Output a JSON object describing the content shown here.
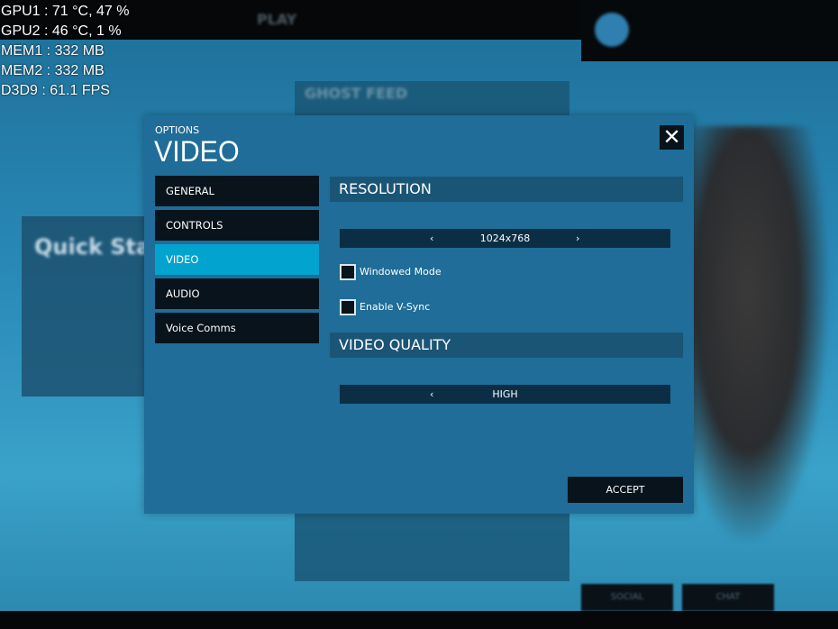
{
  "background": {
    "play_label": "PLAY",
    "feed_title": "GHOST FEED",
    "quick_start": "Quick Start",
    "social_tab": "SOCIAL",
    "chat_tab": "CHAT"
  },
  "hud": {
    "lines": [
      "GPU1  : 71 °C, 47 %",
      "GPU2  : 46 °C, 1 %",
      "MEM1 : 332 MB",
      "MEM2 : 332 MB",
      "D3D9  : 61.1 FPS"
    ]
  },
  "modal": {
    "subtitle": "OPTIONS",
    "title": "VIDEO",
    "close_icon": "close-x",
    "nav": [
      {
        "label": "GENERAL",
        "active": false
      },
      {
        "label": "CONTROLS",
        "active": false
      },
      {
        "label": "VIDEO",
        "active": true
      },
      {
        "label": "AUDIO",
        "active": false
      },
      {
        "label": "Voice Comms",
        "active": false
      }
    ],
    "resolution": {
      "heading": "RESOLUTION",
      "value": "1024x768",
      "prev": "‹",
      "next": "›"
    },
    "windowed_mode": {
      "label": "Windowed Mode",
      "checked": false
    },
    "vsync": {
      "label": "Enable V-Sync",
      "checked": false
    },
    "quality": {
      "heading": "VIDEO QUALITY",
      "value": "HIGH",
      "prev": "‹"
    },
    "accept_label": "ACCEPT"
  },
  "colors": {
    "active_tab": "#02a3cf",
    "modal_bg": "#1f6d98",
    "dark": "#08131b"
  }
}
